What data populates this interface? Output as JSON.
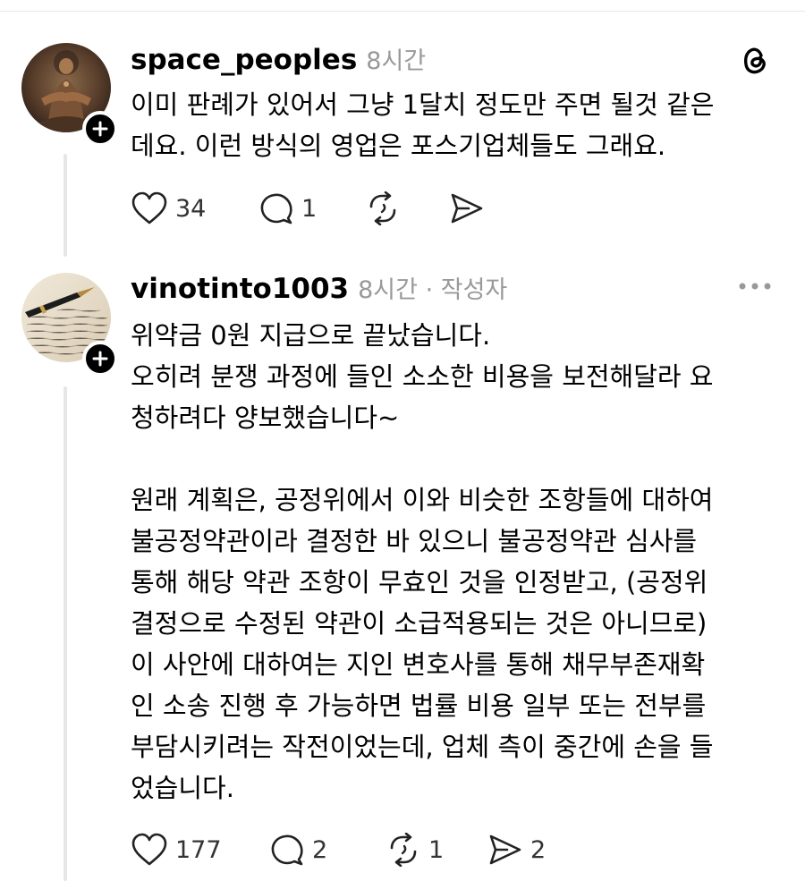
{
  "posts": [
    {
      "username": "space_peoples",
      "meta": "8시간",
      "body": "이미 판례가 있어서 그냥 1달치 정도만 주면 될것 같은\n데요. 이런 방식의 영업은 포스기업체들도 그래요.",
      "likes": "34",
      "replies": "1",
      "reposts": "",
      "shares": "",
      "corner_icon": "threads-logo-icon"
    },
    {
      "username": "vinotinto1003",
      "meta": "8시간 · 작성자",
      "body": "위약금 0원 지급으로 끝났습니다.\n오히려 분쟁 과정에 들인 소소한 비용을 보전해달라 요\n청하려다 양보했습니다~\n\n원래 계획은, 공정위에서 이와 비슷한 조항들에 대하여\n불공정약관이라 결정한 바 있으니 불공정약관 심사를\n통해 해당 약관 조항이 무효인 것을 인정받고, (공정위\n결정으로 수정된 약관이 소급적용되는 것은 아니므로)\n이 사안에 대하여는 지인 변호사를 통해 채무부존재확\n인 소송 진행 후 가능하면 법률 비용 일부 또는 전부를\n부담시키려는 작전이었는데, 업체 측이 중간에 손을 들\n었습니다.",
      "likes": "177",
      "replies": "2",
      "reposts": "1",
      "shares": "2",
      "corner_icon": "more-options-icon"
    }
  ],
  "colors": {
    "meta_gray": "#999999",
    "thread_line": "#e6e6e6",
    "icon_dark": "#333333"
  }
}
